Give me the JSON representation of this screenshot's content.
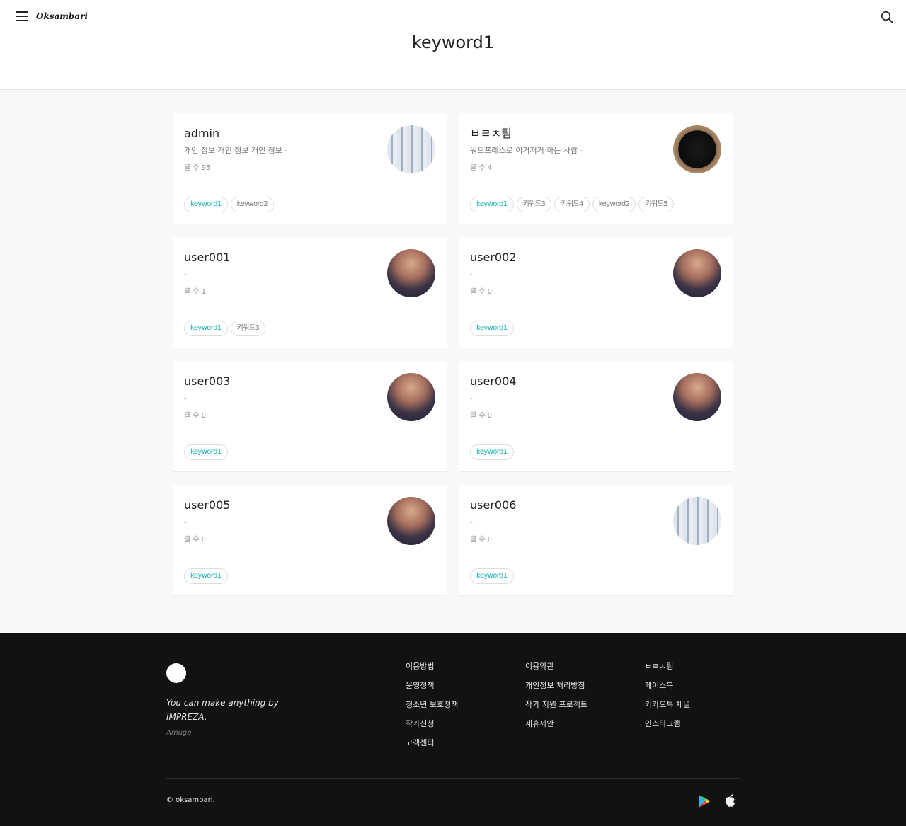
{
  "header": {
    "logo": "Oksambari",
    "title": "keyword1",
    "menu_icon": "hamburger-menu-icon",
    "search_icon": "search-icon"
  },
  "count_label": "글 수",
  "cards": [
    {
      "name": "admin",
      "description": "개인 정보 개인 정보 개인 정보 -",
      "count": "95",
      "avatar": "desk",
      "tags": [
        "keyword1",
        "keyword2"
      ]
    },
    {
      "name": "ㅂㄹㅊ팀",
      "description": "워드프레스로 이거저거 하는 사람 -",
      "count": "4",
      "avatar": "dog",
      "tags": [
        "keyword1",
        "키워드3",
        "키워드4",
        "keyword2",
        "키워드5"
      ]
    },
    {
      "name": "user001",
      "description": "-",
      "count": "1",
      "avatar": "dusk",
      "tags": [
        "keyword1",
        "키워드3"
      ]
    },
    {
      "name": "user002",
      "description": "-",
      "count": "0",
      "avatar": "dusk",
      "tags": [
        "keyword1"
      ]
    },
    {
      "name": "user003",
      "description": "-",
      "count": "0",
      "avatar": "dusk",
      "tags": [
        "keyword1"
      ]
    },
    {
      "name": "user004",
      "description": "-",
      "count": "0",
      "avatar": "dusk",
      "tags": [
        "keyword1"
      ]
    },
    {
      "name": "user005",
      "description": "-",
      "count": "0",
      "avatar": "dusk",
      "tags": [
        "keyword1"
      ]
    },
    {
      "name": "user006",
      "description": "-",
      "count": "0",
      "avatar": "desk",
      "tags": [
        "keyword1"
      ]
    }
  ],
  "active_tag": "keyword1",
  "colors": {
    "accent": "#18b6ad",
    "footer_bg": "#121212",
    "page_bg": "#f8f8f8"
  },
  "footer": {
    "tagline": "You can make anything by IMPREZA.",
    "sub": "Amuge",
    "col1": [
      "이용방법",
      "운영정책",
      "청소년 보호정책",
      "작가신청",
      "고객센터"
    ],
    "col2": [
      "이용약관",
      "개인정보 처리방침",
      "작가 지원 프로젝트",
      "제휴제안"
    ],
    "col3": [
      "ㅂㄹㅊ팀",
      "페이스북",
      "카카오톡 채널",
      "인스타그램"
    ],
    "copyright": "© oksambari.",
    "store_icons": [
      "google-play-icon",
      "apple-icon"
    ]
  }
}
